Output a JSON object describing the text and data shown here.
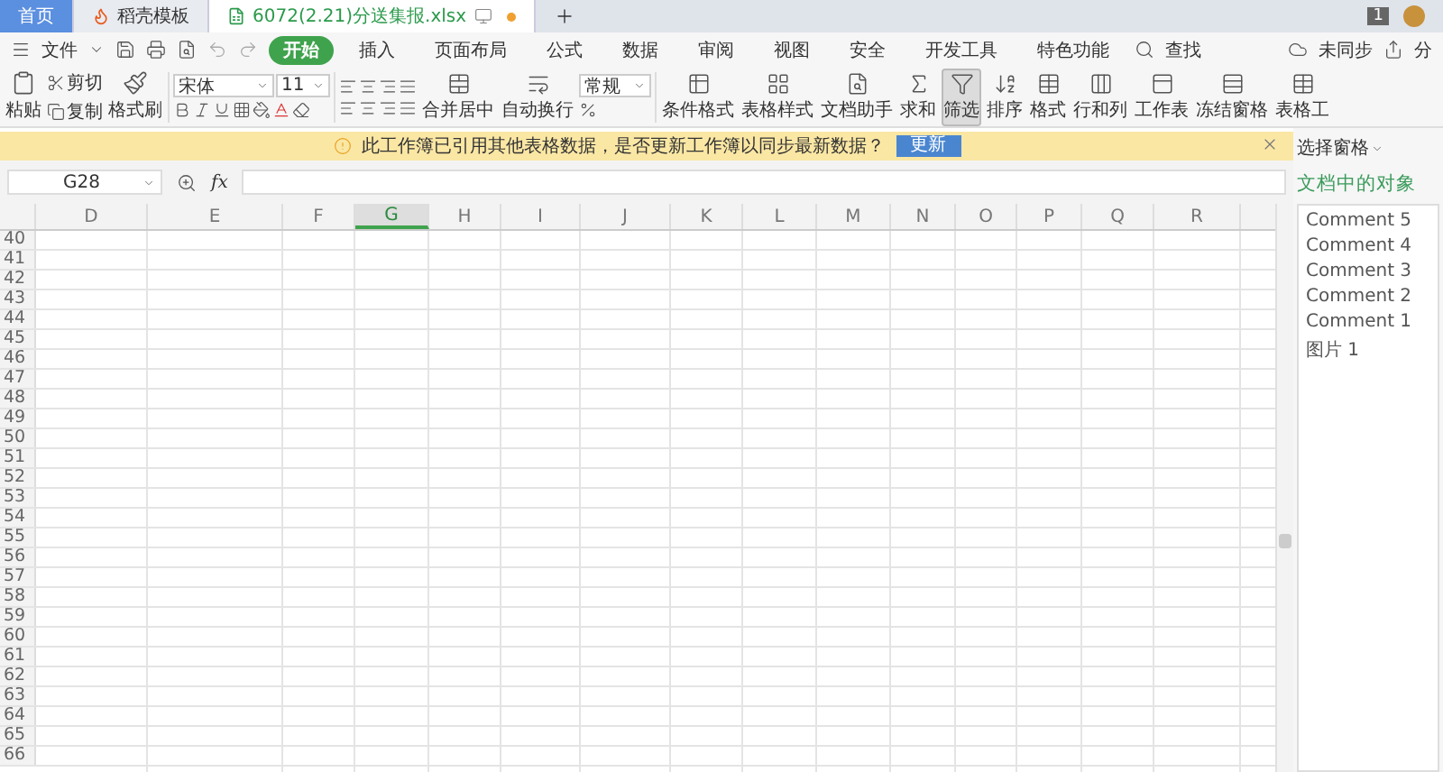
{
  "tabs": [
    {
      "label": "首页",
      "selected": false,
      "kind": "home"
    },
    {
      "label": "稻壳模板",
      "selected": false,
      "kind": "doc"
    },
    {
      "label": "6072(2.21)分送集报.xlsx",
      "selected": true,
      "kind": "sheet"
    }
  ],
  "badge": "1",
  "menu": {
    "file": "文件",
    "items": [
      {
        "label": "开始",
        "selected": true
      },
      {
        "label": "插入",
        "selected": false
      },
      {
        "label": "页面布局",
        "selected": false
      },
      {
        "label": "公式",
        "selected": false
      },
      {
        "label": "数据",
        "selected": false
      },
      {
        "label": "审阅",
        "selected": false
      },
      {
        "label": "视图",
        "selected": false
      },
      {
        "label": "安全",
        "selected": false
      },
      {
        "label": "开发工具",
        "selected": false
      },
      {
        "label": "特色功能",
        "selected": false
      }
    ],
    "search": "查找",
    "sync": "未同步",
    "share": "分"
  },
  "toolbar": {
    "paste": "粘贴",
    "cut": "剪切",
    "copy": "复制",
    "format_painter": "格式刷",
    "font": "宋体",
    "size": "11",
    "merge": "合并居中",
    "wrap": "自动换行",
    "number_format": "常规",
    "buttons": [
      {
        "label": "条件格式",
        "kind": "cond",
        "selected": false
      },
      {
        "label": "表格样式",
        "kind": "style",
        "selected": false
      },
      {
        "label": "文档助手",
        "kind": "doc",
        "selected": false
      },
      {
        "label": "求和",
        "kind": "sum",
        "selected": false
      },
      {
        "label": "筛选",
        "kind": "filter",
        "selected": true
      },
      {
        "label": "排序",
        "kind": "sort",
        "selected": false
      },
      {
        "label": "格式",
        "kind": "format",
        "selected": false
      },
      {
        "label": "行和列",
        "kind": "rows",
        "selected": false
      },
      {
        "label": "工作表",
        "kind": "sheet",
        "selected": false
      },
      {
        "label": "冻结窗格",
        "kind": "freeze",
        "selected": false
      },
      {
        "label": "表格工",
        "kind": "tools",
        "selected": false
      }
    ]
  },
  "notice": {
    "text": "此工作簿已引用其他表格数据，是否更新工作簿以同步最新数据？",
    "button": "更新"
  },
  "formula": {
    "cell": "G28",
    "fx": "fx"
  },
  "sheet": {
    "columns": [
      {
        "label": "D",
        "selected": false
      },
      {
        "label": "E",
        "selected": false
      },
      {
        "label": "F",
        "selected": false
      },
      {
        "label": "G",
        "selected": true
      },
      {
        "label": "H",
        "selected": false
      },
      {
        "label": "I",
        "selected": false
      },
      {
        "label": "J",
        "selected": false
      },
      {
        "label": "K",
        "selected": false
      },
      {
        "label": "L",
        "selected": false
      },
      {
        "label": "M",
        "selected": false
      },
      {
        "label": "N",
        "selected": false
      },
      {
        "label": "O",
        "selected": false
      },
      {
        "label": "P",
        "selected": false
      },
      {
        "label": "Q",
        "selected": false
      },
      {
        "label": "R",
        "selected": false
      }
    ],
    "rows": [
      "40",
      "41",
      "42",
      "43",
      "44",
      "45",
      "46",
      "47",
      "48",
      "49",
      "50",
      "51",
      "52",
      "53",
      "54",
      "55",
      "56",
      "57",
      "58",
      "59",
      "60",
      "61",
      "62",
      "63",
      "64",
      "65",
      "66"
    ]
  },
  "pane": {
    "title": "选择窗格",
    "heading": "文档中的对象",
    "items": [
      "Comment 5",
      "Comment 4",
      "Comment 3",
      "Comment 2",
      "Comment 1",
      "图片 1"
    ]
  }
}
